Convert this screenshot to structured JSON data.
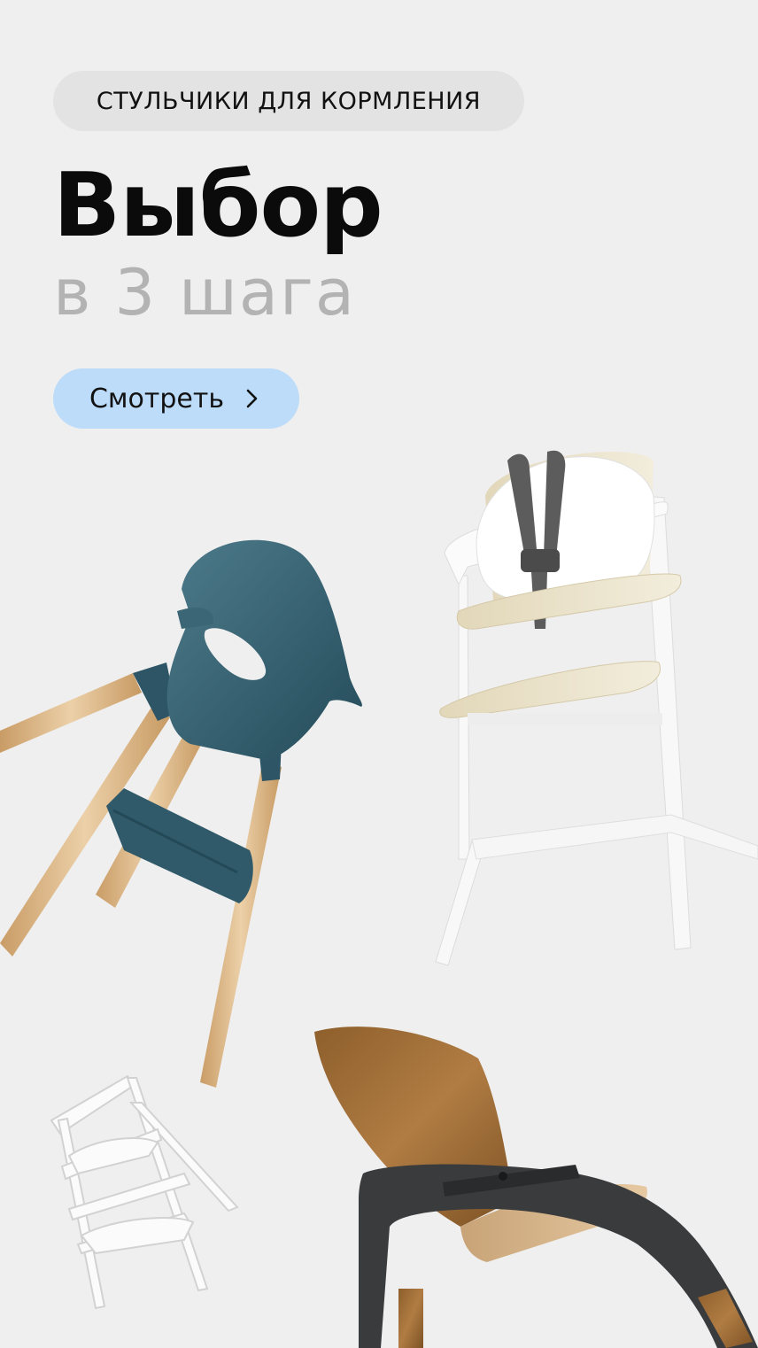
{
  "banner": {
    "category_label": "СТУЛЬЧИКИ ДЛЯ КОРМЛЕНИЯ",
    "headline": "Выбор",
    "subheadline": "в 3 шага",
    "cta_label": "Смотреть",
    "cta_icon": "chevron-right-icon"
  },
  "colors": {
    "background": "#efefef",
    "pill_background": "#e3e3e3",
    "cta_background": "#bcdcf9",
    "subheadline": "#b3b3b3",
    "teal_chair": "#2f5968",
    "wood": "#d9b588"
  },
  "images": [
    "teal-highchair-image",
    "white-highchair-image",
    "white-folding-chair-image",
    "wood-dark-highchair-image"
  ]
}
